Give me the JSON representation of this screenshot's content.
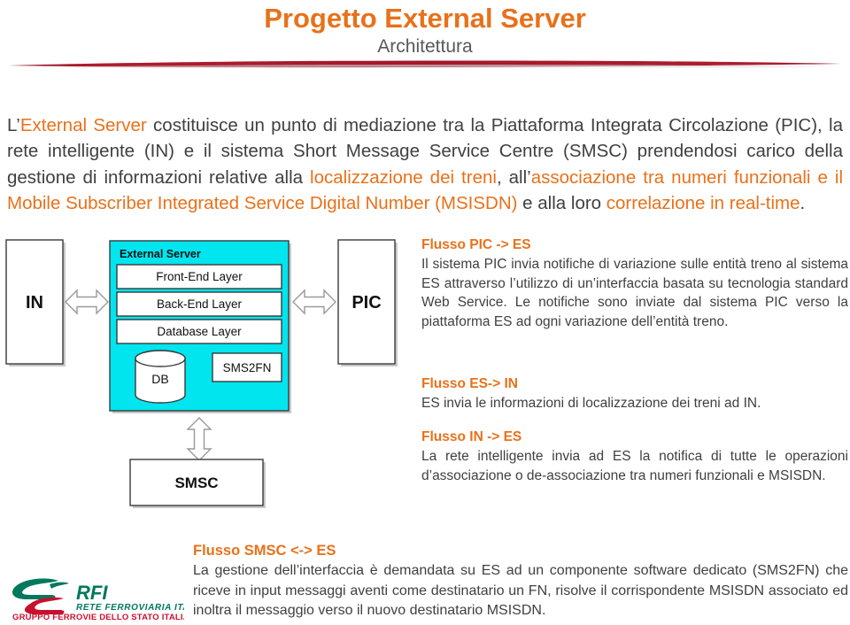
{
  "header": {
    "title": "Progetto External Server",
    "subtitle": "Architettura",
    "accent_color": "#E8711A",
    "rule_color": "#A8182B"
  },
  "intro": {
    "segments": [
      {
        "text": "L’",
        "highlight": false
      },
      {
        "text": "External Server",
        "highlight": true
      },
      {
        "text": " costituisce un punto di mediazione tra la Piattaforma Integrata Circolazione (PIC), la rete intelligente (IN) e il sistema Short Message Service Centre (SMSC) prendendosi carico della gestione di informazioni relative alla ",
        "highlight": false
      },
      {
        "text": "localizzazione dei treni",
        "highlight": true
      },
      {
        "text": ", all’",
        "highlight": false
      },
      {
        "text": "associazione tra numeri funzionali e il Mobile Subscriber Integrated Service Digital Number (MSISDN)",
        "highlight": true
      },
      {
        "text": " e alla loro ",
        "highlight": false
      },
      {
        "text": "correlazione in real-time",
        "highlight": true
      },
      {
        "text": ".",
        "highlight": false
      }
    ]
  },
  "diagram": {
    "left_node": "IN",
    "right_node": "PIC",
    "bottom_node": "SMSC",
    "server_title": "External Server",
    "server_fill": "#00E5EE",
    "layers": [
      "Front-End Layer",
      "Back-End Layer",
      "Database Layer"
    ],
    "db_label": "DB",
    "sms2fn_label": "SMS2FN"
  },
  "flows": {
    "pic_es": {
      "heading": "Flusso PIC -> ES",
      "body": "Il sistema PIC invia notifiche di variazione sulle entità treno al sistema ES attraverso l’utilizzo di un’interfaccia basata su tecnologia standard Web Service. Le notifiche sono inviate dal sistema PIC verso la piattaforma ES ad ogni variazione dell’entità treno."
    },
    "es_in": {
      "heading": "Flusso ES-> IN",
      "body": "ES invia le informazioni di localizzazione dei treni ad IN."
    },
    "in_es": {
      "heading": "Flusso IN -> ES",
      "body": "La rete intelligente invia ad ES la notifica di tutte le operazioni d’associazione o de-associazione tra numeri funzionali e MSISDN."
    },
    "smsc_es": {
      "heading": "Flusso SMSC <-> ES",
      "body": "La gestione dell’interfaccia è demandata su ES ad un componente software dedicato (SMS2FN) che riceve in input messaggi aventi come destinatario un FN, risolve il corrispondente MSISDN associato ed inoltra il messaggio verso il nuovo destinatario MSISDN."
    }
  },
  "logo": {
    "brand": "RFI",
    "line1": "RETE FERROVIARIA ITALIANA",
    "line2": "GRUPPO FERROVIE DELLO STATO ITALIANE",
    "green": "#00795C",
    "red": "#C8102E"
  }
}
